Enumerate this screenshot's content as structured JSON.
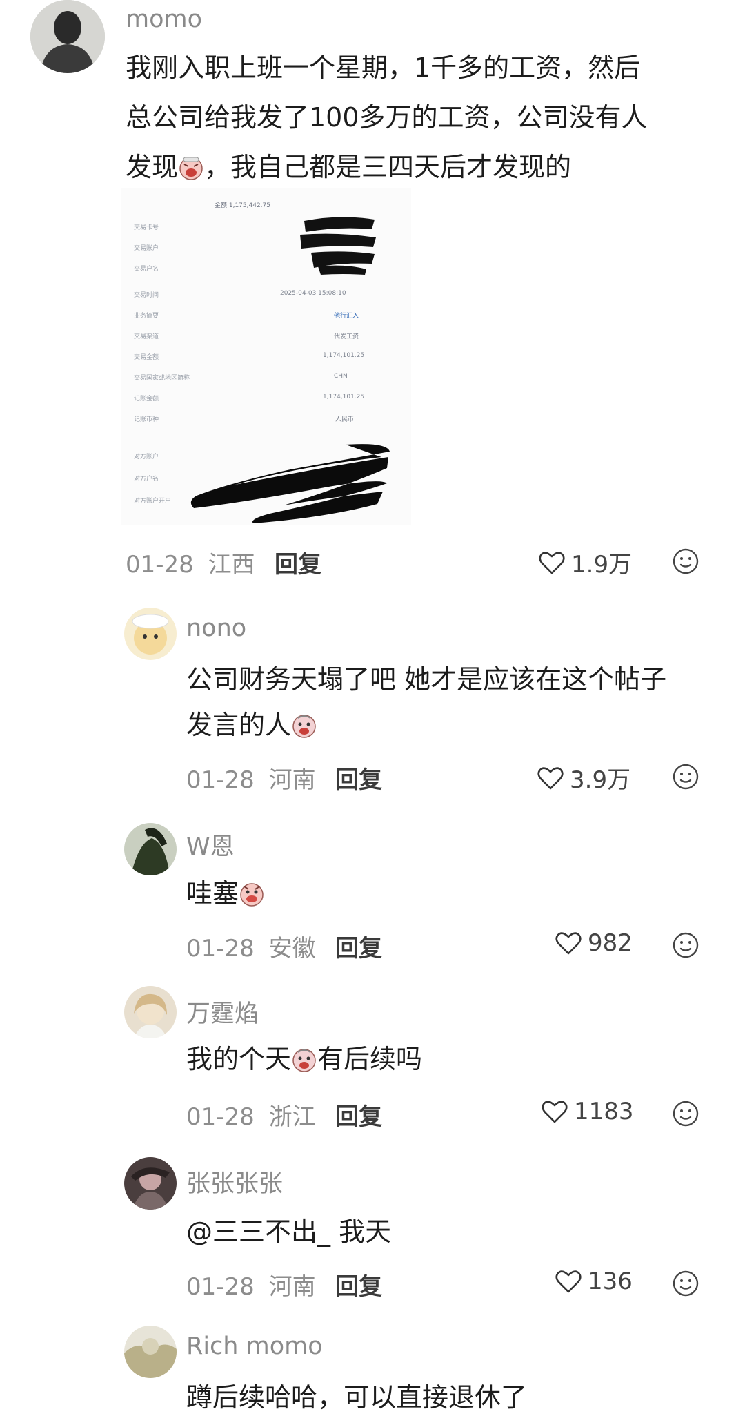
{
  "post": {
    "author": "momo",
    "text_lines": [
      "我刚入职上班一个星期，1千多的工资，然后",
      "总公司给我发了100多万的工资，公司没有人",
      "发现",
      "，我自己都是三四天后才发现的"
    ],
    "date": "01-28",
    "location": "江西",
    "reply_label": "回复",
    "likes": "1.9万"
  },
  "receipt": {
    "header": "金额 1,175,442.75",
    "labels": [
      "交易卡号",
      "交易账户",
      "交易户名",
      "交易时间",
      "业务摘要",
      "交易渠道",
      "交易金额",
      "交易国家或地区简称",
      "记账金额",
      "记账币种",
      "对方账户",
      "对方户名",
      "对方账户开户"
    ],
    "values": [
      "2025-04-03 15:08:10",
      "他行汇入",
      "代发工资",
      "1,174,101.25",
      "CHN",
      "1,174,101.25",
      "人民币"
    ]
  },
  "comments": [
    {
      "author": "nono",
      "lines": [
        "公司财务天塌了吧 她才是应该在这个帖子",
        "发言的人"
      ],
      "date": "01-28",
      "location": "河南",
      "reply_label": "回复",
      "likes": "3.9万"
    },
    {
      "author": "W恩",
      "lines": [
        "哇塞"
      ],
      "date": "01-28",
      "location": "安徽",
      "reply_label": "回复",
      "likes": "982"
    },
    {
      "author": "万霆焰",
      "lines": [
        "我的个天",
        "有后续吗"
      ],
      "date": "01-28",
      "location": "浙江",
      "reply_label": "回复",
      "likes": "1183"
    },
    {
      "author": "张张张张",
      "lines": [
        "@三三不出_  我天"
      ],
      "date": "01-28",
      "location": "河南",
      "reply_label": "回复",
      "likes": "136"
    },
    {
      "author": "Rich momo",
      "lines": [
        "蹲后续哈哈，可以直接退休了"
      ]
    }
  ],
  "icons": {
    "like": "heart-outline-icon",
    "emoji": "smiley-face-icon",
    "inline_emoji": "crying-face-sticker-icon"
  },
  "colors": {
    "name": "#8a8a8a",
    "meta": "#8d8d8d",
    "text": "#1c1c1c",
    "receipt_bg": "#fbfbfb"
  }
}
